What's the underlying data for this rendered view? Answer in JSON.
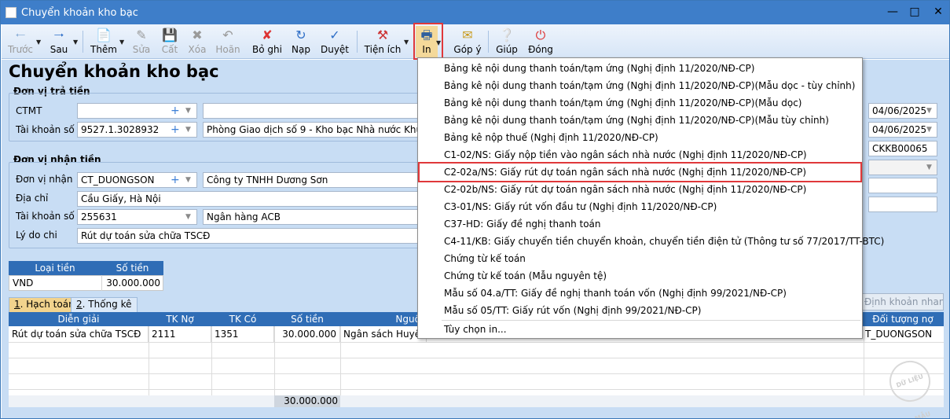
{
  "window": {
    "title": "Chuyển khoản kho bạc"
  },
  "toolbar": {
    "back": "Trước",
    "forward": "Sau",
    "add": "Thêm",
    "edit": "Sửa",
    "copy": "Cất",
    "delete": "Xóa",
    "undo": "Hoãn",
    "unpost": "Bỏ ghi",
    "reload": "Nạp",
    "approve": "Duyệt",
    "utilities": "Tiện ích",
    "print": "In",
    "feedback": "Góp ý",
    "help": "Giúp",
    "close": "Đóng"
  },
  "page": {
    "title": "Chuyển khoản kho bạc"
  },
  "payer": {
    "section": "Đơn vị trả tiền",
    "ctmt_label": "CTMT",
    "ctmt_value": "",
    "account_label": "Tài khoản số",
    "account_value": "9527.1.3028932",
    "bank_name": "Phòng Giao dịch số 9 - Kho bạc Nhà nước Khu vực I"
  },
  "payee": {
    "section": "Đơn vị nhận tiền",
    "unit_label": "Đơn vị nhận",
    "unit_value": "CT_DUONGSON",
    "unit_name": "Công ty TNHH Dương Sơn",
    "address_label": "Địa chỉ",
    "address_value": "Cầu Giấy, Hà Nội",
    "account_label": "Tài khoản số",
    "account_value": "255631",
    "bank_name": "Ngân hàng ACB",
    "reason_label": "Lý do chi",
    "reason_value": "Rút dự toán sửa chữa TSCĐ"
  },
  "right_fields": {
    "date1": "04/06/2025",
    "date2": "04/06/2025",
    "doc_no": "CKKB00065"
  },
  "currency_table": {
    "headers": [
      "Loại tiền",
      "Số tiền"
    ],
    "row": [
      "VND",
      "30.000.000"
    ]
  },
  "tabs": [
    {
      "num": "1",
      "label": ". Hạch toán"
    },
    {
      "num": "2",
      "label": ". Thống kê"
    }
  ],
  "quick_account_button": "Định khoản nhanh",
  "grid": {
    "headers": [
      "Diễn giải",
      "TK Nợ",
      "TK Có",
      "Số tiền",
      "Nguồn",
      "Đối tượng nợ"
    ],
    "row": [
      "Rút dự toán sửa chữa TSCĐ",
      "2111",
      "1351",
      "30.000.000",
      "Ngân sách Huyện t",
      "T_DUONGSON"
    ],
    "total": "30.000.000"
  },
  "print_menu": {
    "items": [
      "Bảng kê nội dung thanh toán/tạm ứng (Nghị định 11/2020/NĐ-CP)",
      "Bảng kê nội dung thanh toán/tạm ứng (Nghị định 11/2020/NĐ-CP)(Mẫu dọc - tùy chỉnh)",
      "Bảng kê nội dung thanh toán/tạm ứng (Nghị định 11/2020/NĐ-CP)(Mẫu dọc)",
      "Bảng kê nội dung thanh toán/tạm ứng (Nghị định 11/2020/NĐ-CP)(Mẫu tùy chỉnh)",
      "Bảng kê nộp thuế (Nghị định 11/2020/NĐ-CP)",
      "C1-02/NS: Giấy nộp tiền vào ngân sách nhà nước (Nghị định 11/2020/NĐ-CP)",
      "C2-02a/NS: Giấy rút dự toán ngân sách nhà nước (Nghị định 11/2020/NĐ-CP)",
      "C2-02b/NS: Giấy rút dự toán ngân sách nhà nước (Nghị định 11/2020/NĐ-CP)",
      "C3-01/NS: Giấy rút vốn đầu tư (Nghị định 11/2020/NĐ-CP)",
      "C37-HD: Giấy đề nghị thanh toán",
      "C4-11/KB: Giấy chuyển tiền chuyển khoản, chuyển tiền điện tử (Thông tư số 77/2017/TT-BTC)",
      "Chứng từ kế toán",
      "Chứng từ kế toán (Mẫu nguyên tệ)",
      "Mẫu số 04.a/TT: Giấy đề nghị thanh toán vốn (Nghị định 99/2021/NĐ-CP)",
      "Mẫu số 05/TT: Giấy rút vốn (Nghị định 99/2021/NĐ-CP)"
    ],
    "options": "Tùy chọn in..."
  },
  "watermark": "DỮ LIỆU MẪU",
  "colors": {
    "titlebar": "#3e7ec9",
    "form_bg": "#c8ddf4",
    "grid_header": "#2f6db6",
    "highlight": "#e0383b"
  }
}
